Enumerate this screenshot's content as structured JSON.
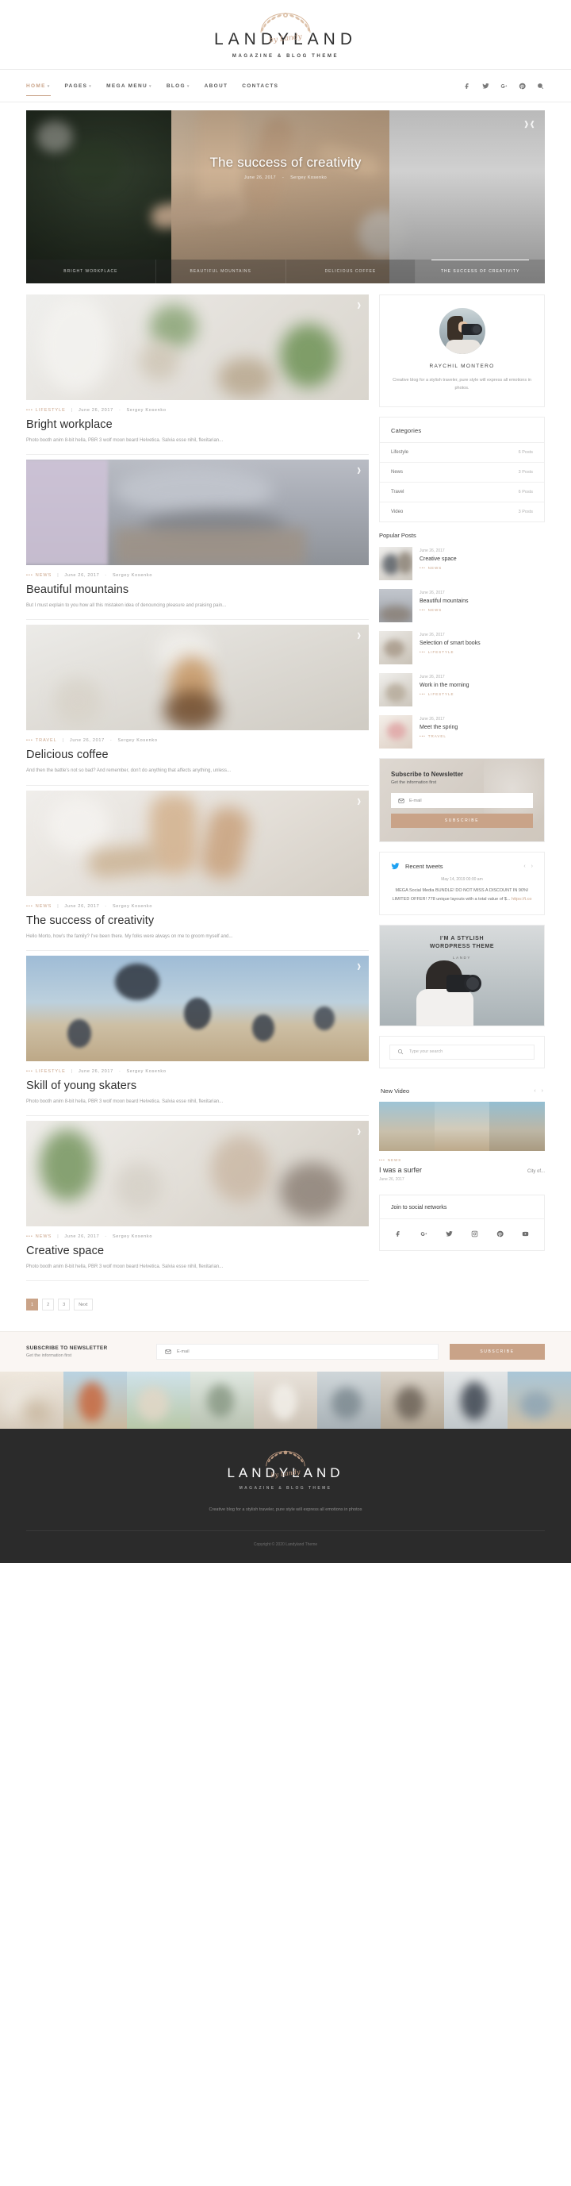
{
  "header": {
    "logo": "LANDYLAND",
    "logo_script": "by Landy",
    "tagline": "MAGAZINE & BLOG THEME",
    "nav": [
      {
        "label": "HOME",
        "caret": "▾",
        "active": true
      },
      {
        "label": "PAGES",
        "caret": "▾",
        "active": false
      },
      {
        "label": "MEGA MENU",
        "caret": "▾",
        "active": false
      },
      {
        "label": "BLOG",
        "caret": "▾",
        "active": false
      },
      {
        "label": "ABOUT",
        "caret": "",
        "active": false
      },
      {
        "label": "CONTACTS",
        "caret": "",
        "active": false
      }
    ],
    "social": [
      "facebook-icon",
      "twitter-icon",
      "google-plus-icon",
      "pinterest-icon",
      "search-icon"
    ]
  },
  "hero": {
    "title": "The success of creativity",
    "date": "June 26, 2017",
    "author": "Sergey Kosenko",
    "separator": "-",
    "share_icon": "share-icon",
    "thumbs": [
      {
        "label": "BRIGHT WORKPLACE",
        "active": false
      },
      {
        "label": "BEAUTIFUL MOUNTAINS",
        "active": false
      },
      {
        "label": "DELICIOUS COFFEE",
        "active": false
      },
      {
        "label": "THE SUCCESS OF CREATIVITY",
        "active": true
      }
    ]
  },
  "posts": [
    {
      "category": "LIFESTYLE",
      "date": "June 26, 2017",
      "author": "Sergey Kosenko",
      "title": "Bright workplace",
      "excerpt": "Photo booth anim 8-bit hella, PBR 3 wolf moon beard Helvetica. Salvia esse nihil, flexitarian..."
    },
    {
      "category": "NEWS",
      "date": "June 26, 2017",
      "author": "Sergey Kosenko",
      "title": "Beautiful mountains",
      "excerpt": "But I must explain to you how all this mistaken idea of denouncing pleasure and praising pain..."
    },
    {
      "category": "TRAVEL",
      "date": "June 26, 2017",
      "author": "Sergey Kosenko",
      "title": "Delicious coffee",
      "excerpt": "And then the battle's not so bad? And remember, don't do anything that affects anything, unless..."
    },
    {
      "category": "NEWS",
      "date": "June 26, 2017",
      "author": "Sergey Kosenko",
      "title": "The success of creativity",
      "excerpt": "Hello Morto, how's the family? I've been there. My folks were always on me to groom myself and..."
    },
    {
      "category": "LIFESTYLE",
      "date": "June 26, 2017",
      "author": "Sergey Kosenko",
      "title": "Skill of young skaters",
      "excerpt": "Photo booth anim 8-bit hella, PBR 3 wolf moon beard Helvetica. Salvia esse nihil, flexitarian..."
    },
    {
      "category": "NEWS",
      "date": "June 26, 2017",
      "author": "Sergey Kosenko",
      "title": "Creative space",
      "excerpt": "Photo booth anim 8-bit hella, PBR 3 wolf moon beard Helvetica. Salvia esse nihil, flexitarian..."
    }
  ],
  "pagination": {
    "pages": [
      "1",
      "2",
      "3"
    ],
    "next": "Next",
    "active": "1"
  },
  "sidebar": {
    "author": {
      "name": "RAYCHIL MONTERO",
      "bio": "Creative blog for a stylish traveler, pure style will express all emotions in photos."
    },
    "categories": {
      "title": "Categories",
      "items": [
        {
          "name": "Lifestyle",
          "count": "6 Posts"
        },
        {
          "name": "News",
          "count": "3 Posts"
        },
        {
          "name": "Travel",
          "count": "6 Posts"
        },
        {
          "name": "Video",
          "count": "3 Posts"
        }
      ]
    },
    "popular": {
      "title": "Popular Posts",
      "items": [
        {
          "date": "June 26, 2017",
          "name": "Creative space",
          "cat": "NEWS"
        },
        {
          "date": "June 26, 2017",
          "name": "Beautiful mountains",
          "cat": "NEWS"
        },
        {
          "date": "June 26, 2017",
          "name": "Selection of smart books",
          "cat": "LIFESTYLE"
        },
        {
          "date": "June 26, 2017",
          "name": "Work in the morning",
          "cat": "LIFESTYLE"
        },
        {
          "date": "June 26, 2017",
          "name": "Meet the spring",
          "cat": "TRAVEL"
        }
      ]
    },
    "newsletter": {
      "title": "Subscribe to Newsletter",
      "subtitle": "Get the information first",
      "placeholder": "E-mail",
      "button": "SUBSCRIBE",
      "mail_icon": "mail-icon"
    },
    "tweets": {
      "title": "Recent tweets",
      "icon": "twitter-icon",
      "date": "May 14, 2019 00:00 am",
      "text": "MEGA Social Media BUNDLE! DO NOT MISS A DISCOUNT IN 90%! LIMITED OFFER! 778 unique layouts with a total value of $...",
      "link": "https://t.co",
      "prev": "‹",
      "next": "›"
    },
    "promo": {
      "line1": "I'M A STYLISH",
      "line2": "WORDPRESS THEME",
      "badge": "LANDY"
    },
    "search": {
      "placeholder": "Type your search",
      "icon": "search-icon"
    },
    "new_video": {
      "title": "New Video",
      "cat": "NEWS",
      "name": "I was a surfer",
      "city": "City of...",
      "date": "June 26, 2017",
      "prev": "‹",
      "next": "›"
    },
    "social": {
      "title": "Join to social networks",
      "icons": [
        "facebook-icon",
        "google-plus-icon",
        "twitter-icon",
        "instagram-icon",
        "pinterest-icon",
        "youtube-icon"
      ]
    }
  },
  "footer_subscribe": {
    "title": "SUBSCRIBE TO NEWSLETTER",
    "subtitle": "Get the information first",
    "placeholder": "E-mail",
    "button": "SUBSCRIBE",
    "mail_icon": "mail-icon"
  },
  "footer": {
    "logo": "LANDYLAND",
    "logo_script": "by Landy",
    "tagline": "MAGAZINE & BLOG THEME",
    "description": "Creative blog for a stylish traveler, pure style will express all emotions in photos",
    "copyright": "Copyright © 2020 Landyland Theme"
  },
  "colors": {
    "accent": "#c9a388",
    "text_dark": "#2f2f2f",
    "text_muted": "#9b9b9b",
    "footer_bg": "#2b2b2b"
  }
}
